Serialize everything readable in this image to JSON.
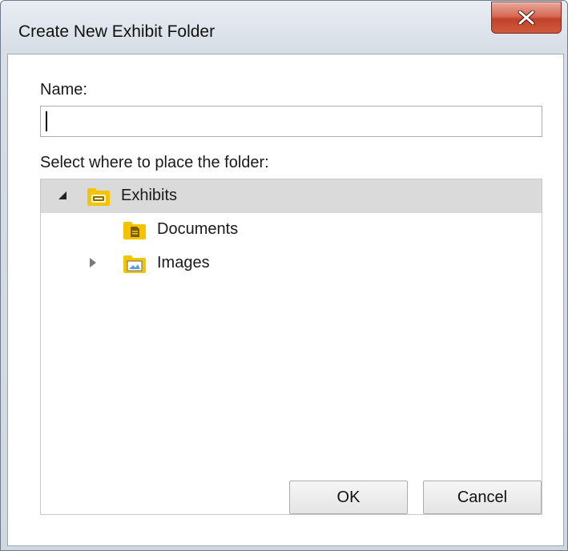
{
  "window": {
    "title": "Create New Exhibit Folder",
    "close_glyph": "close-icon"
  },
  "form": {
    "name_label": "Name:",
    "name_value": "",
    "location_label": "Select where to place the folder:"
  },
  "tree": {
    "items": [
      {
        "label": "Exhibits",
        "level": 0,
        "expanded": true,
        "selected": true,
        "icon": "exhibits-folder-icon"
      },
      {
        "label": "Documents",
        "level": 1,
        "expanded": null,
        "selected": false,
        "icon": "documents-folder-icon"
      },
      {
        "label": "Images",
        "level": 1,
        "expanded": false,
        "selected": false,
        "icon": "images-folder-icon"
      }
    ]
  },
  "buttons": {
    "ok_label": "OK",
    "cancel_label": "Cancel"
  },
  "colors": {
    "folder": "#f5c400",
    "close_button": "#c7452f",
    "selection": "#dadada"
  }
}
